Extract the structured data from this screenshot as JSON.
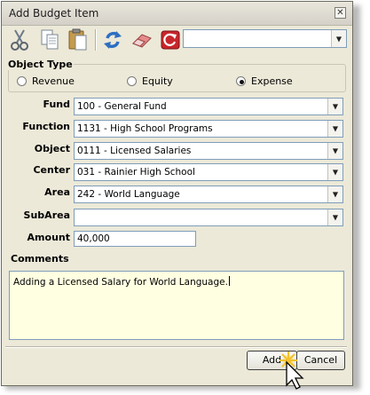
{
  "window": {
    "title": "Add Budget Item",
    "close_glyph": "✕"
  },
  "toolbar": {
    "icons": [
      "cut-icon",
      "copy-icon",
      "paste-icon",
      "refresh-icon",
      "eraser-icon",
      "reset-icon"
    ],
    "combo_value": ""
  },
  "object_type": {
    "label": "Object Type",
    "options": [
      {
        "label": "Revenue",
        "selected": false
      },
      {
        "label": "Equity",
        "selected": false
      },
      {
        "label": "Expense",
        "selected": true
      }
    ]
  },
  "fields": {
    "fund": {
      "label": "Fund",
      "value": "100 - General Fund"
    },
    "function": {
      "label": "Function",
      "value": "1131 - High School Programs"
    },
    "object": {
      "label": "Object",
      "value": "0111 - Licensed Salaries"
    },
    "center": {
      "label": "Center",
      "value": "031 - Rainier High School"
    },
    "area": {
      "label": "Area",
      "value": "242 - World Language"
    },
    "subarea": {
      "label": "SubArea",
      "value": ""
    },
    "amount": {
      "label": "Amount",
      "value": "40,000"
    }
  },
  "comments": {
    "label": "Comments",
    "value": "Adding a Licensed Salary for World Language."
  },
  "buttons": {
    "add": "Add",
    "cancel": "Cancel"
  },
  "colors": {
    "comments_bg": "#ffffe1",
    "window_bg": "#ece9d8",
    "field_border": "#7f9db9"
  }
}
